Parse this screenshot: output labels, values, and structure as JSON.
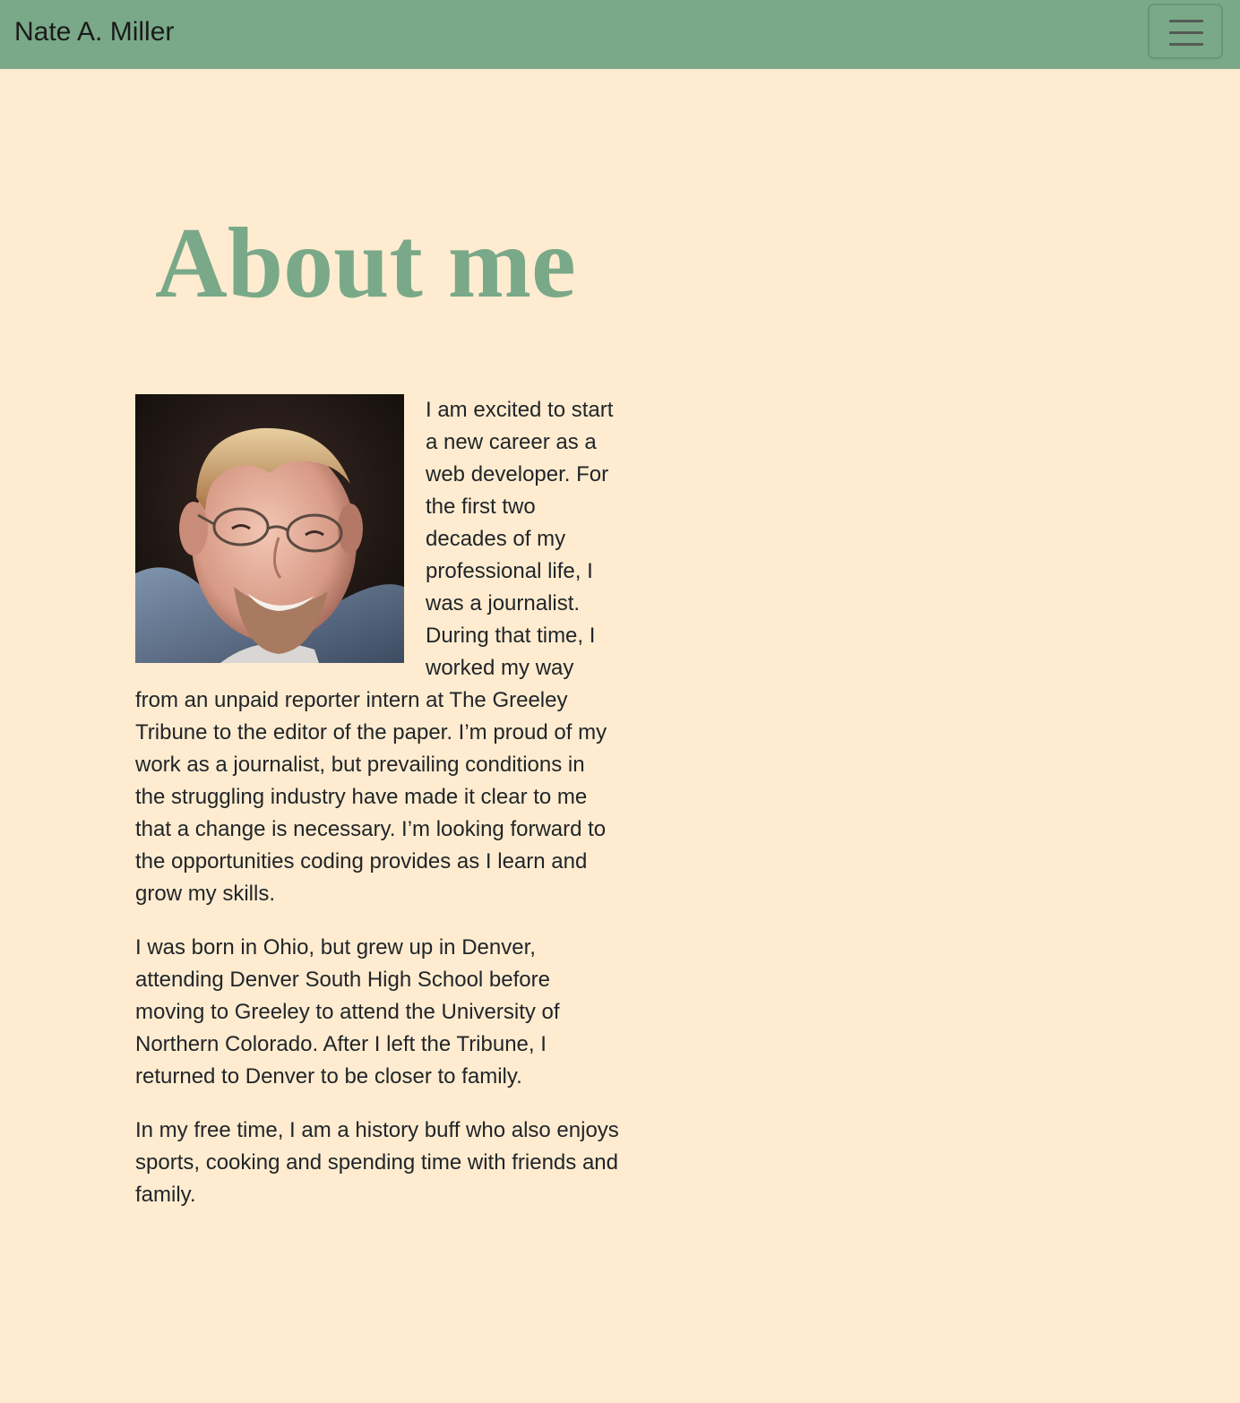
{
  "navbar": {
    "brand": "Nate A. Miller",
    "toggle_icon": "hamburger-menu-icon"
  },
  "main": {
    "title": "About me",
    "portrait_icon": "portrait-photo",
    "paragraphs": [
      "I am excited to start a new career as a web developer. For the first two decades of my professional life, I was a journalist. During that time, I worked my way from an unpaid reporter intern at The Greeley Tribune to the editor of the paper. I’m proud of my work as a journalist, but prevailing conditions in the struggling industry have made it clear to me that a change is necessary. I’m looking forward to the opportunities coding provides as I learn and grow my skills.",
      "I was born in Ohio, but grew up in Denver, attending Denver South High School before moving to Greeley to attend the University of Northern Colorado. After I left the Tribune, I returned to Denver to be closer to family.",
      "In my free time, I am a history buff who also enjoys sports, cooking and spending time with friends and family."
    ]
  },
  "colors": {
    "background": "#ffecd0",
    "navbar": "#79a988",
    "title": "#79a988",
    "text": "#212529"
  }
}
